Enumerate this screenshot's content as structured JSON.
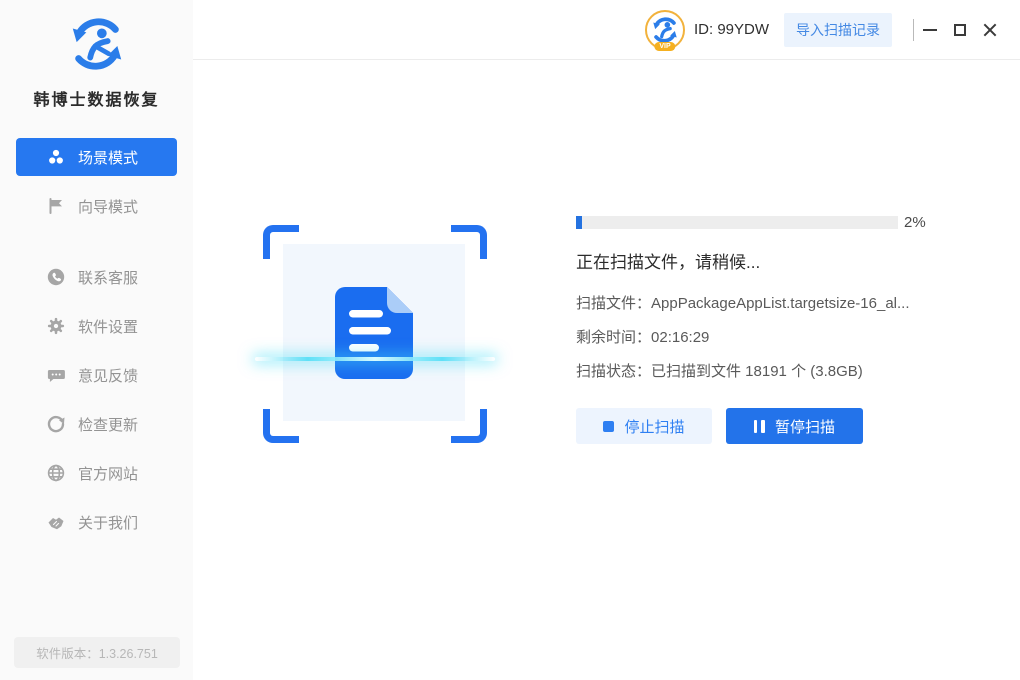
{
  "app": {
    "name": "韩博士数据恢复",
    "version": "软件版本：1.3.26.751"
  },
  "header": {
    "user_id": "ID: 99YDW",
    "vip_badge": "VIP",
    "import_button": "导入扫描记录"
  },
  "sidebar": {
    "items": [
      {
        "label": "场景模式",
        "icon": "group-icon",
        "active": true
      },
      {
        "label": "向导模式",
        "icon": "flag-icon",
        "active": false
      },
      {
        "label": "联系客服",
        "icon": "phone-icon",
        "active": false
      },
      {
        "label": "软件设置",
        "icon": "gear-icon",
        "active": false
      },
      {
        "label": "意见反馈",
        "icon": "feedback-icon",
        "active": false
      },
      {
        "label": "检查更新",
        "icon": "update-icon",
        "active": false
      },
      {
        "label": "官方网站",
        "icon": "globe-icon",
        "active": false
      },
      {
        "label": "关于我们",
        "icon": "handshake-icon",
        "active": false
      }
    ]
  },
  "scan": {
    "progress_value": 2,
    "progress_percent_label": "2%",
    "status_title": "正在扫描文件，请稍候...",
    "file_label": "扫描文件：",
    "file_value": "AppPackageAppList.targetsize-16_al...",
    "time_label": "剩余时间：",
    "time_value": "02:16:29",
    "state_label": "扫描状态：",
    "state_value": "已扫描到文件 18191 个 (3.8GB)",
    "stop_button": "停止扫描",
    "pause_button": "暂停扫描"
  },
  "colors": {
    "accent_blue": "#2678f0",
    "button_blue": "#2373ea",
    "light_blue_bg": "#ebf3fd",
    "scanline_cyan": "#45dcf6",
    "progress_fill": "#2472e0"
  }
}
